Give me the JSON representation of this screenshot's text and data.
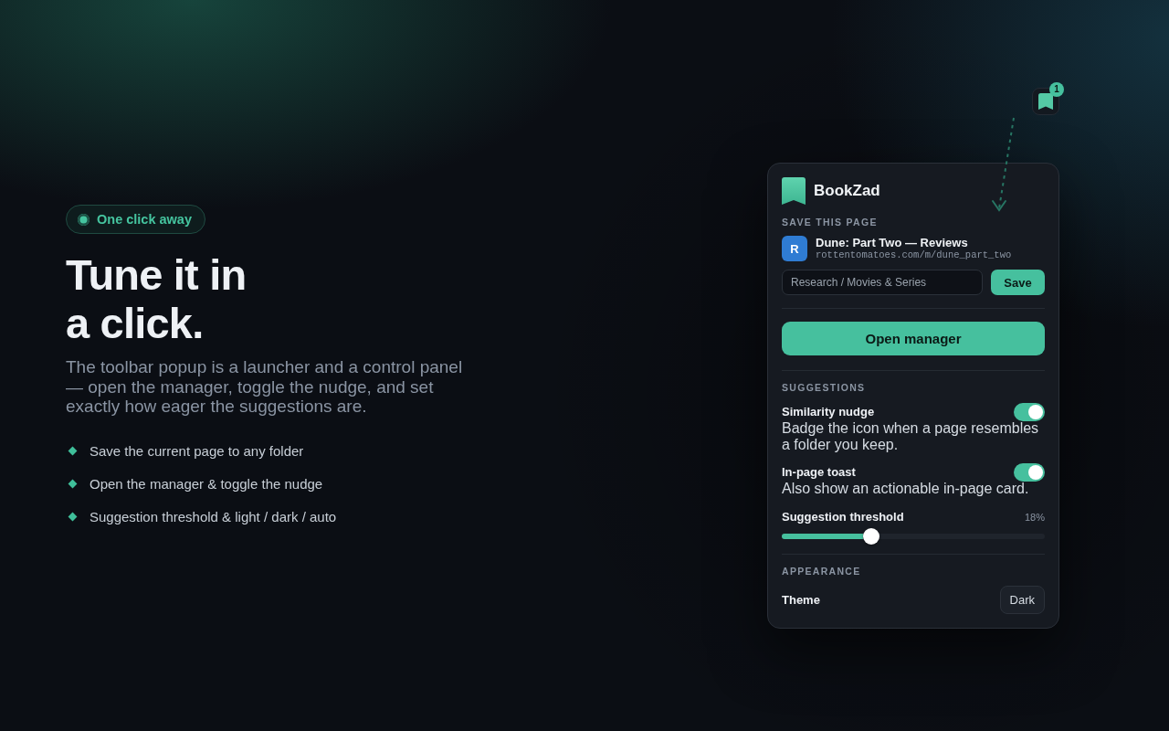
{
  "hero": {
    "pill": "One click away",
    "heading": "Tune it in a click.",
    "paragraph": "The toolbar popup is a launcher and a control panel — open the manager, toggle the nudge, and set exactly how eager the suggestions are.",
    "bullets": [
      "Save the current page to any folder",
      "Open the manager & toggle the nudge",
      "Suggestion threshold & light / dark / auto"
    ]
  },
  "toolbar_button": {
    "badge": "1"
  },
  "popup": {
    "brand": "BookZad",
    "save_section": {
      "heading": "SAVE THIS PAGE",
      "page": {
        "avatar": "R",
        "title": "Dune: Part Two — Reviews",
        "url": "rottentomatoes.com/m/dune_part_two"
      },
      "folder": {
        "value": "Research / Movies & Series"
      },
      "save_button": "Save"
    },
    "open_manager_button": "Open manager",
    "suggestions": {
      "heading": "SUGGESTIONS",
      "settings": [
        {
          "kind": "toggle",
          "label": "Similarity nudge",
          "description": "Badge the icon when a page resembles a folder you keep.",
          "on": true
        },
        {
          "kind": "toggle",
          "label": "In-page toast",
          "description": "Also show an actionable in-page card.",
          "on": true
        },
        {
          "kind": "slider",
          "label": "Suggestion threshold",
          "reading": "18%",
          "level": 0.34
        }
      ]
    },
    "appearance": {
      "heading": "APPEARANCE",
      "theme": {
        "label": "Theme",
        "value": "Dark"
      }
    }
  }
}
